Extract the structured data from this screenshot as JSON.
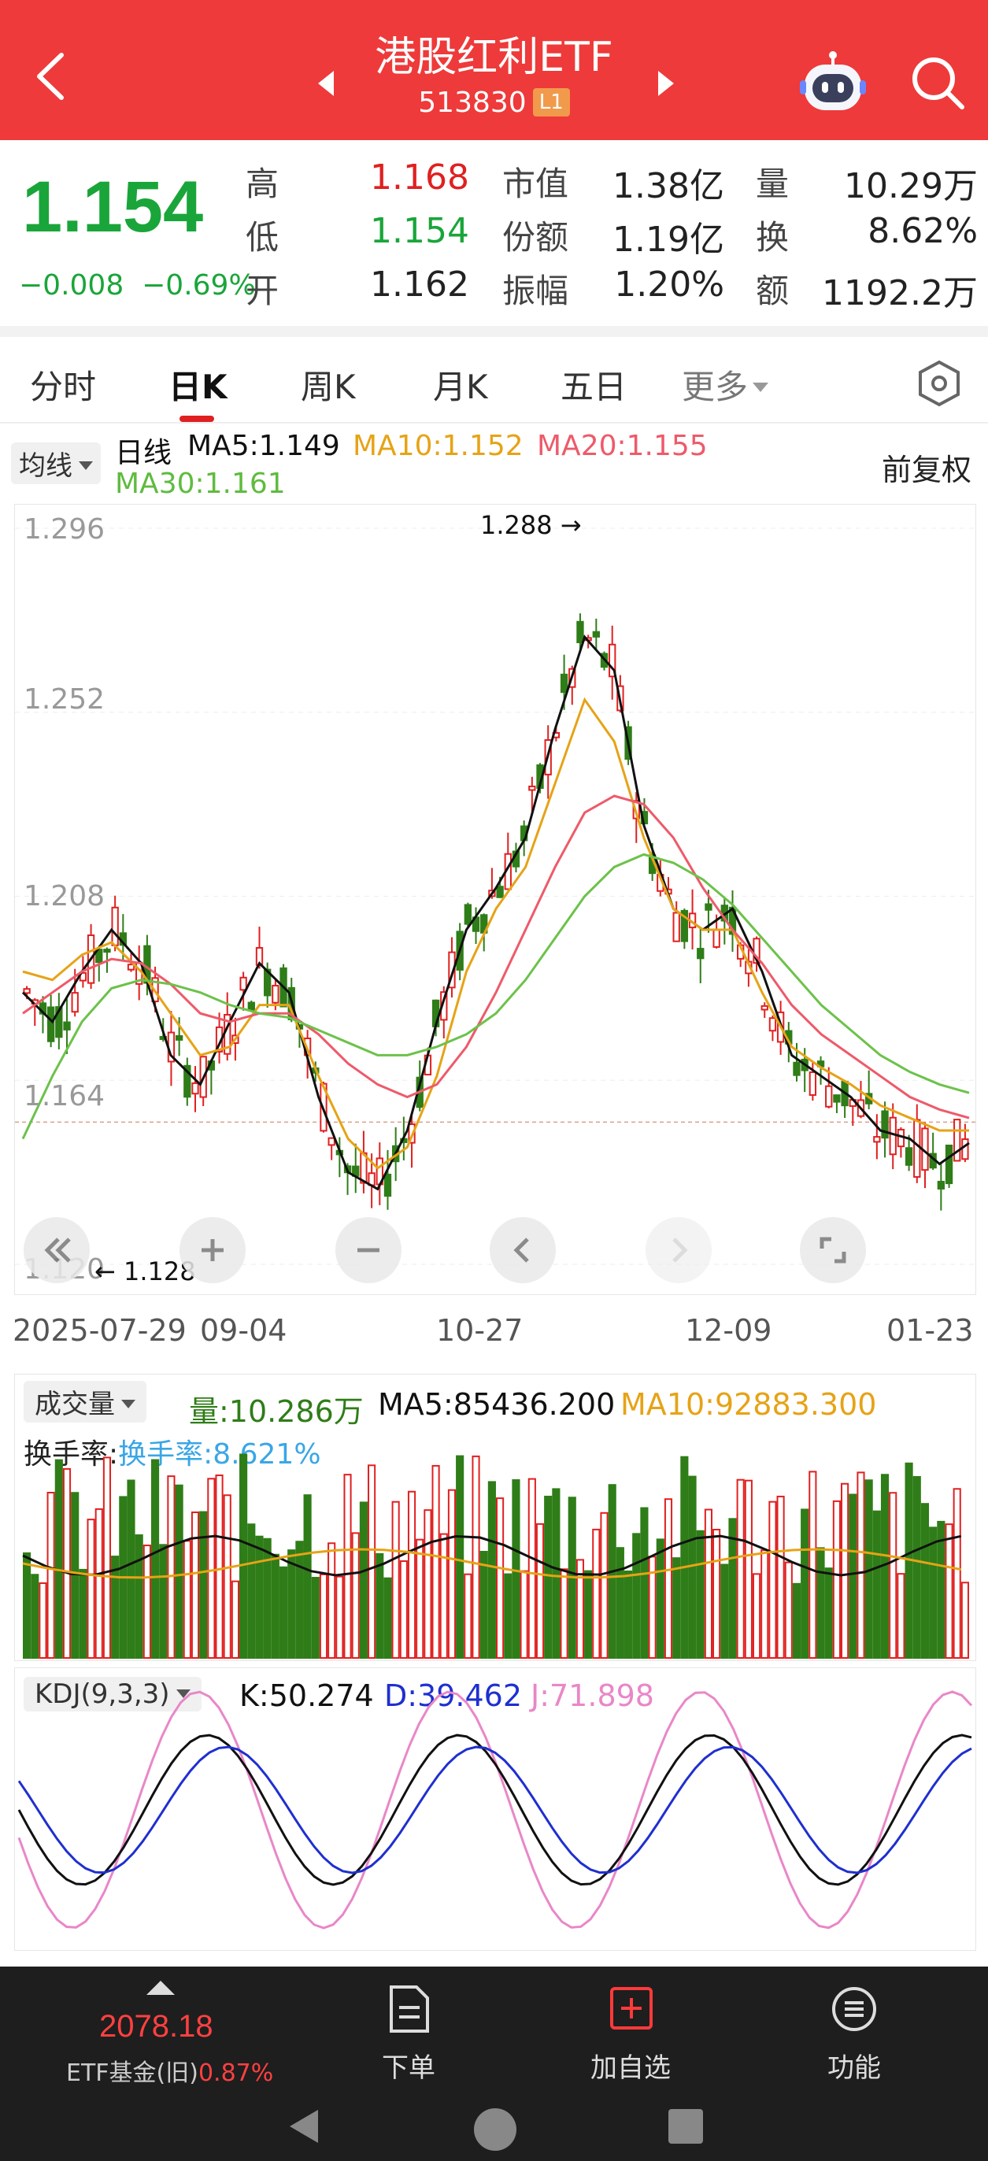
{
  "header": {
    "title": "港股红利ETF",
    "code": "513830",
    "level_badge": "L1"
  },
  "quote": {
    "price": "1.154",
    "change": "−0.008",
    "change_pct": "−0.69%",
    "high_label": "高",
    "high": "1.168",
    "low_label": "低",
    "low": "1.154",
    "open_label": "开",
    "open": "1.162",
    "mktcap_label": "市值",
    "mktcap": "1.38亿",
    "shares_label": "份额",
    "shares": "1.19亿",
    "amp_label": "振幅",
    "amp": "1.20%",
    "vol_label": "量",
    "vol": "10.29万",
    "turn_label": "换",
    "turn": "8.62%",
    "amt_label": "额",
    "amt": "1192.2万"
  },
  "tabs": [
    "分时",
    "日K",
    "周K",
    "月K",
    "五日",
    "更多"
  ],
  "indicators": {
    "selector": "均线",
    "kline_label": "日线",
    "ma5": "MA5:1.149",
    "ma10": "MA10:1.152",
    "ma20": "MA20:1.155",
    "ma30": "MA30:1.161",
    "adjust": "前复权"
  },
  "colors": {
    "up": "#e02020",
    "down": "#2f7d18",
    "ma5": "#111111",
    "ma10": "#e6a316",
    "ma20": "#ee5a6a",
    "ma30": "#6cc24a",
    "k": "#111111",
    "d": "#1f2fd0",
    "j": "#e987c8",
    "header": "#ee3a3a"
  },
  "chart_data": [
    {
      "type": "candlestick",
      "title": "日线",
      "y_ticks": [
        "1.296",
        "1.252",
        "1.208",
        "1.164",
        "1.120"
      ],
      "ylim": [
        1.12,
        1.296
      ],
      "x_ticks": [
        "2025-07-29",
        "09-04",
        "10-27",
        "12-09",
        "01-23"
      ],
      "annotations": {
        "max": "1.288",
        "min": "1.128"
      },
      "series": [
        {
          "name": "MA5",
          "values": [
            1.185,
            1.178,
            1.19,
            1.2,
            1.192,
            1.17,
            1.163,
            1.178,
            1.192,
            1.185,
            1.16,
            1.142,
            1.138,
            1.152,
            1.178,
            1.2,
            1.21,
            1.222,
            1.248,
            1.27,
            1.262,
            1.225,
            1.205,
            1.2,
            1.205,
            1.19,
            1.17,
            1.165,
            1.16,
            1.152,
            1.15,
            1.144,
            1.149
          ]
        },
        {
          "name": "MA10",
          "values": [
            1.19,
            1.188,
            1.194,
            1.197,
            1.19,
            1.18,
            1.17,
            1.172,
            1.182,
            1.182,
            1.165,
            1.15,
            1.143,
            1.148,
            1.165,
            1.19,
            1.205,
            1.215,
            1.235,
            1.255,
            1.245,
            1.222,
            1.205,
            1.2,
            1.2,
            1.185,
            1.172,
            1.167,
            1.163,
            1.158,
            1.155,
            1.152,
            1.152
          ]
        },
        {
          "name": "MA20",
          "values": [
            1.18,
            1.185,
            1.19,
            1.193,
            1.192,
            1.187,
            1.18,
            1.178,
            1.18,
            1.18,
            1.175,
            1.168,
            1.163,
            1.16,
            1.163,
            1.172,
            1.185,
            1.2,
            1.215,
            1.228,
            1.232,
            1.23,
            1.222,
            1.21,
            1.2,
            1.192,
            1.182,
            1.175,
            1.17,
            1.165,
            1.16,
            1.157,
            1.155
          ]
        },
        {
          "name": "MA30",
          "values": [
            1.15,
            1.165,
            1.178,
            1.186,
            1.188,
            1.187,
            1.185,
            1.182,
            1.18,
            1.179,
            1.176,
            1.173,
            1.17,
            1.17,
            1.172,
            1.175,
            1.18,
            1.188,
            1.198,
            1.208,
            1.215,
            1.218,
            1.216,
            1.212,
            1.206,
            1.198,
            1.19,
            1.182,
            1.176,
            1.17,
            1.166,
            1.163,
            1.161
          ]
        }
      ]
    },
    {
      "type": "bar",
      "title": "成交量",
      "series_labels": {
        "vol": "量:10.286万",
        "ma5": "MA5:85436.200",
        "ma10": "MA10:92883.300",
        "turnover": "换手率:8.621%"
      }
    },
    {
      "type": "line",
      "title": "KDJ(9,3,3)",
      "series_labels": {
        "k": "K:50.274",
        "d": "D:39.462",
        "j": "J:71.898"
      }
    }
  ],
  "bottom": {
    "index_value": "2078.18",
    "index_name": "ETF基金(旧)",
    "index_pct": "0.87%",
    "order": "下单",
    "add": "加自选",
    "func": "功能"
  }
}
